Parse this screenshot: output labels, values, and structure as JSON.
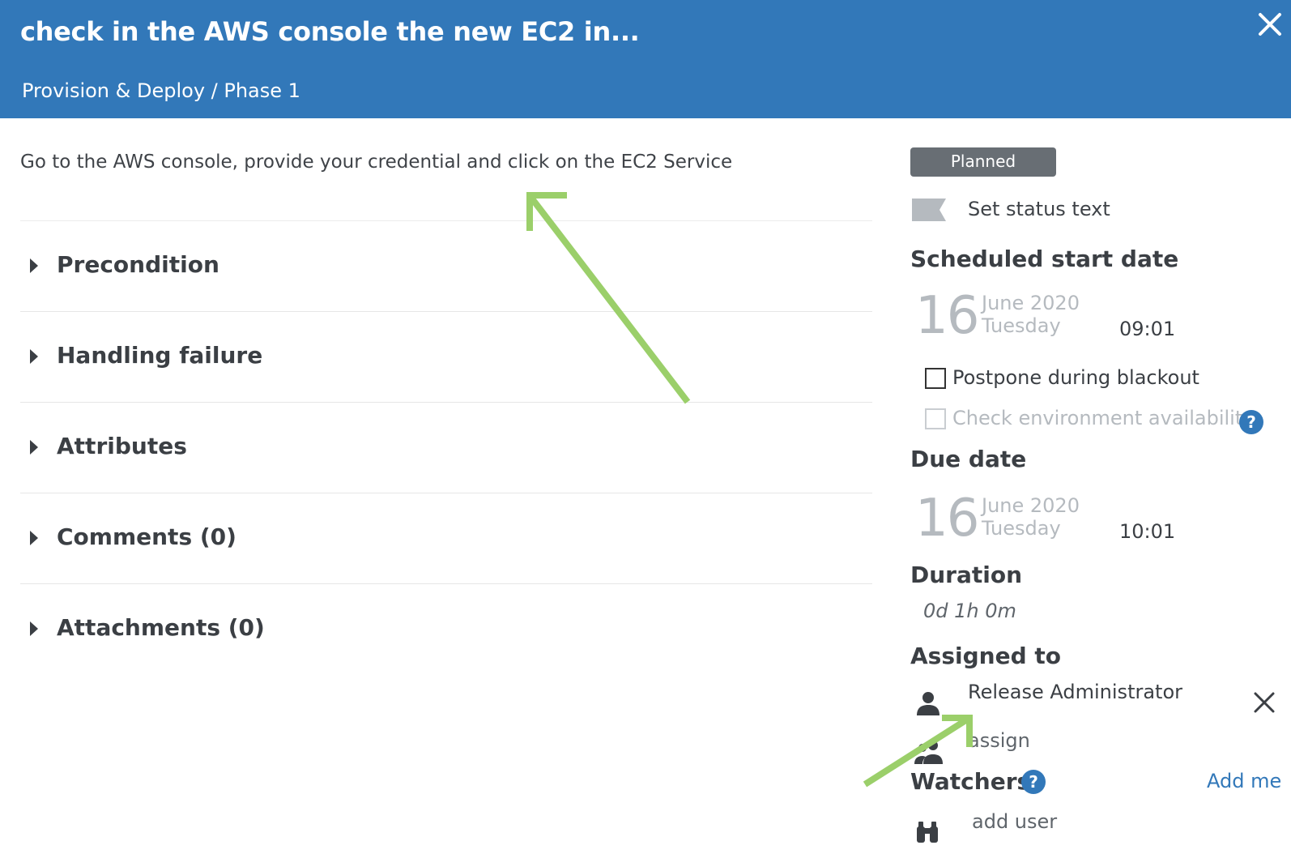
{
  "header": {
    "title": "check in the AWS console the new EC2 in...",
    "breadcrumb": "Provision & Deploy / Phase 1",
    "close_icon": "close-icon"
  },
  "description": "Go to the AWS console, provide your credential and click on the EC2 Service",
  "sections": [
    {
      "label": "Precondition"
    },
    {
      "label": "Handling failure"
    },
    {
      "label": "Attributes"
    },
    {
      "label": "Comments (0)"
    },
    {
      "label": "Attachments (0)"
    }
  ],
  "sidebar": {
    "status": "Planned",
    "set_status_text": "Set status text",
    "scheduled_start": {
      "heading": "Scheduled start date",
      "day": "16",
      "month_year": "June 2020",
      "weekday": "Tuesday",
      "time": "09:01"
    },
    "postpone_blackout": {
      "label": "Postpone during blackout",
      "checked": false
    },
    "check_env": {
      "label": "Check environment availability",
      "checked": false,
      "disabled": true
    },
    "due_date": {
      "heading": "Due date",
      "day": "16",
      "month_year": "June 2020",
      "weekday": "Tuesday",
      "time": "10:01"
    },
    "duration": {
      "heading": "Duration",
      "value": "0d 1h 0m"
    },
    "assigned_to": {
      "heading": "Assigned to",
      "name": "Release Administrator",
      "assign_label": "assign"
    },
    "watchers": {
      "heading": "Watchers",
      "add_me": "Add me",
      "add_user": "add user"
    }
  },
  "colors": {
    "header_bg": "#3278b9",
    "badge_bg": "#686e74",
    "link": "#3278b9",
    "annotation_arrow": "#9bcf6a"
  }
}
